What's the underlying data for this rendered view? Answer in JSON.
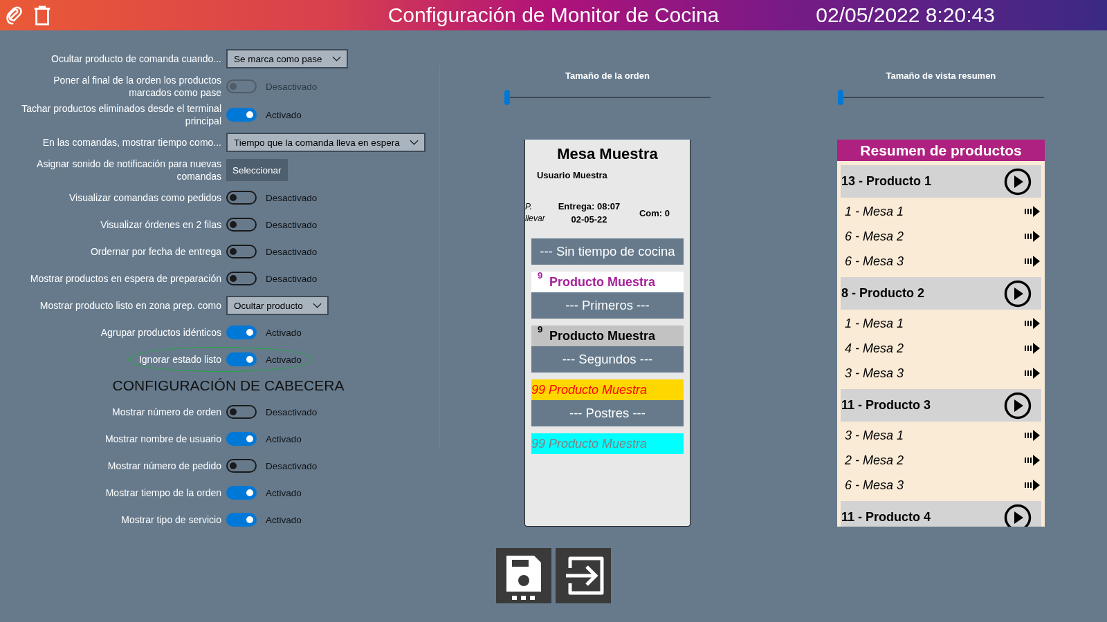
{
  "header": {
    "title": "Configuración de Monitor de Cocina",
    "datetime": "02/05/2022 8:20:43"
  },
  "settings": [
    {
      "kind": "dropdown",
      "label": "Ocultar producto de comanda cuando...",
      "value": "Se marca como pase",
      "highlighted": false
    },
    {
      "kind": "toggle",
      "label": "Poner al final de la orden los productos marcados como pase",
      "on": false,
      "disabled": true,
      "state_text": "Desactivado",
      "highlighted": false
    },
    {
      "kind": "toggle",
      "label": "Tachar productos eliminados desde el terminal principal",
      "on": true,
      "disabled": false,
      "state_text": "Activado",
      "highlighted": false
    },
    {
      "kind": "dropdown",
      "label": "En las comandas, mostrar tiempo como...",
      "value": "Tiempo que la comanda lleva en espera",
      "highlighted": false
    },
    {
      "kind": "button",
      "label": "Asignar sonido de notificación para nuevas comandas",
      "value": "Seleccionar",
      "highlighted": false
    },
    {
      "kind": "toggle",
      "label": "Visualizar comandas como pedidos",
      "on": false,
      "disabled": false,
      "state_text": "Desactivado",
      "highlighted": false
    },
    {
      "kind": "toggle",
      "label": "Visualizar órdenes en 2 filas",
      "on": false,
      "disabled": false,
      "state_text": "Desactivado",
      "highlighted": false
    },
    {
      "kind": "toggle",
      "label": "Ordernar por fecha de entrega",
      "on": false,
      "disabled": false,
      "state_text": "Desactivado",
      "highlighted": false
    },
    {
      "kind": "toggle",
      "label": "Mostrar productos en espera de preparación",
      "on": false,
      "disabled": false,
      "state_text": "Desactivado",
      "highlighted": false
    },
    {
      "kind": "dropdown",
      "label": "Mostrar producto listo en zona prep. como",
      "value": "Ocultar producto",
      "highlighted": false
    },
    {
      "kind": "toggle",
      "label": "Agrupar productos idénticos",
      "on": true,
      "disabled": false,
      "state_text": "Activado",
      "highlighted": false
    },
    {
      "kind": "toggle",
      "label": "Ignorar estado listo",
      "on": true,
      "disabled": false,
      "state_text": "Activado",
      "highlighted": true
    }
  ],
  "header_config": {
    "title": "CONFIGURACIÓN DE CABECERA",
    "settings": [
      {
        "kind": "toggle",
        "label": "Mostrar número de orden",
        "on": false,
        "disabled": false,
        "state_text": "Desactivado",
        "highlighted": false
      },
      {
        "kind": "toggle",
        "label": "Mostrar nombre de usuario",
        "on": true,
        "disabled": false,
        "state_text": "Activado",
        "highlighted": false
      },
      {
        "kind": "toggle",
        "label": "Mostrar número de pedido",
        "on": false,
        "disabled": false,
        "state_text": "Desactivado",
        "highlighted": false
      },
      {
        "kind": "toggle",
        "label": "Mostrar tiempo de la orden",
        "on": true,
        "disabled": false,
        "state_text": "Activado",
        "highlighted": false
      },
      {
        "kind": "toggle",
        "label": "Mostrar tipo de servicio",
        "on": true,
        "disabled": false,
        "state_text": "Activado",
        "highlighted": false
      }
    ]
  },
  "order_size": {
    "label": "Tamaño de la orden",
    "level": 0
  },
  "summary_size": {
    "label": "Tamaño de vista resumen",
    "level": 0
  },
  "order_card": {
    "title": "Mesa Muestra",
    "user": "Usuario Muestra",
    "service": "P. llevar",
    "delivery_time": "Entrega: 08:07",
    "delivery_date": "02-05-22",
    "count": "Com: 0",
    "entries": [
      {
        "kind": "course",
        "text": "--- Sin tiempo de cocina"
      },
      {
        "kind": "marked",
        "qty": "9",
        "name": "Producto Muestra"
      },
      {
        "kind": "course",
        "text": "--- Primeros ---"
      },
      {
        "kind": "plain",
        "qty": "9",
        "name": "Producto Muestra"
      },
      {
        "kind": "course",
        "text": "--- Segundos ---"
      },
      {
        "kind": "late",
        "name": "99 Producto Muestra"
      },
      {
        "kind": "course",
        "text": "--- Postres ---"
      },
      {
        "kind": "ready",
        "name": "99 Producto Muestra"
      }
    ]
  },
  "summary": {
    "title": "Resumen de productos",
    "groups": [
      {
        "label": "13 - Producto 1",
        "children": [
          {
            "label": "1 - Mesa 1"
          },
          {
            "label": "6 - Mesa 2"
          },
          {
            "label": "6 - Mesa 3"
          }
        ]
      },
      {
        "label": "8 - Producto 2",
        "children": [
          {
            "label": "1 - Mesa 1"
          },
          {
            "label": "4 - Mesa 2"
          },
          {
            "label": "3 - Mesa 3"
          }
        ]
      },
      {
        "label": "11 - Producto 3",
        "children": [
          {
            "label": "3 - Mesa 1"
          },
          {
            "label": "2 - Mesa 2"
          },
          {
            "label": "6 - Mesa 3"
          }
        ]
      },
      {
        "label": "11 - Producto 4"
      }
    ]
  },
  "footer_buttons": [
    {
      "kind": "save"
    },
    {
      "kind": "exit"
    }
  ]
}
